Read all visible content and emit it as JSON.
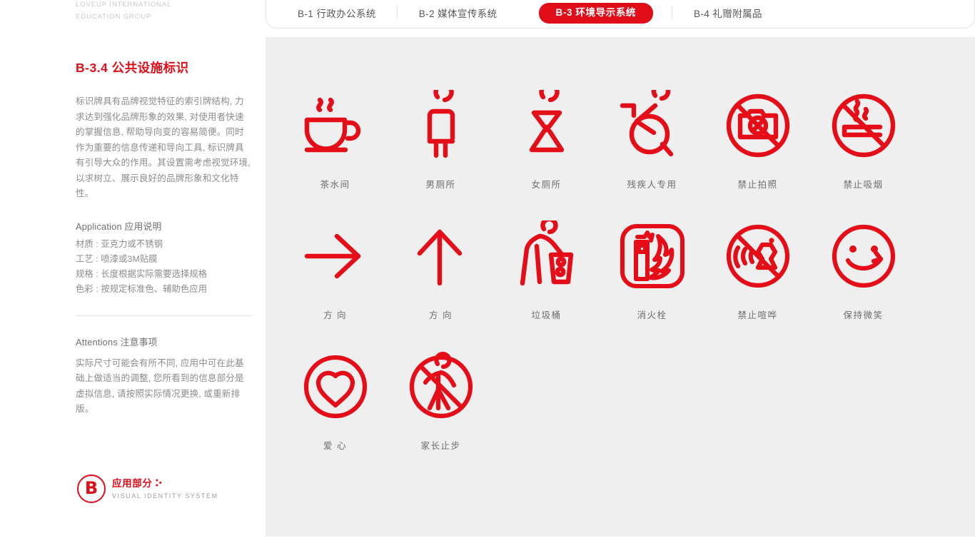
{
  "brand": {
    "line1": "LOVEUP  INTERNATIONAL",
    "line2": "EDUCATION GROUP"
  },
  "colors": {
    "brand_red": "#e00d18",
    "icon_red": "#e40d18",
    "panel_bg": "#efefef",
    "body_text": "#8c8c8c",
    "caption": "#6e6e6e"
  },
  "tabs": [
    {
      "label": "B-1  行政办公系统",
      "active": false
    },
    {
      "label": "B-2  媒体宣传系统",
      "active": false
    },
    {
      "label": "B-3 环境导示系统",
      "active": true
    },
    {
      "label": "B-4 礼赠附属品",
      "active": false
    }
  ],
  "section": {
    "title": "B-3.4  公共设施标识",
    "intro": "标识牌具有品牌视觉特征的索引牌结构, 力求达到强化品牌形象的效果, 对使用者快速的掌握信息, 帮助导向变的容易简便。同时作为重要的信息传递和导向工具, 标识牌具有引导大众的作用。其设置需考虑视觉环境, 以求树立、展示良好的品牌形象和文化特性。",
    "application_heading": "Application 应用说明",
    "application_specs": [
      "材质 : 亚克力或不锈钢",
      "工艺 : 喷漆或3M贴膜",
      "规格 : 长度根据实际需要选择规格",
      "色彩 : 按规定标准色、辅助色应用"
    ],
    "attentions_heading": "Attentions 注意事项",
    "attentions_body": "实际尺寸可能会有所不同, 应用中可在此基础上做适当的调整, 您所看到的信息部分是虚拟信息, 请按照实际情况更换, 或重新排版。"
  },
  "footer_logo": {
    "mark": "B",
    "cn": "应用部分",
    "en": "VISUAL IDENTITY SYSTEM"
  },
  "signs": [
    {
      "label": "茶水间",
      "icon": "tea-room-icon"
    },
    {
      "label": "男厕所",
      "icon": "mens-toilet-icon"
    },
    {
      "label": "女厕所",
      "icon": "womens-toilet-icon"
    },
    {
      "label": "残疾人专用",
      "icon": "wheelchair-accessible-icon"
    },
    {
      "label": "禁止拍照",
      "icon": "no-photography-icon"
    },
    {
      "label": "禁止吸烟",
      "icon": "no-smoking-icon"
    },
    {
      "label": "方 向",
      "icon": "arrow-right-icon"
    },
    {
      "label": "方 向",
      "icon": "arrow-up-icon"
    },
    {
      "label": "垃圾桶",
      "icon": "trash-bin-icon"
    },
    {
      "label": "消火栓",
      "icon": "fire-extinguisher-icon"
    },
    {
      "label": "禁止喧哗",
      "icon": "no-noise-icon"
    },
    {
      "label": "保持微笑",
      "icon": "keep-smiling-icon"
    },
    {
      "label": "爱 心",
      "icon": "love-heart-icon"
    },
    {
      "label": "家长止步",
      "icon": "no-parents-beyond-icon"
    }
  ]
}
